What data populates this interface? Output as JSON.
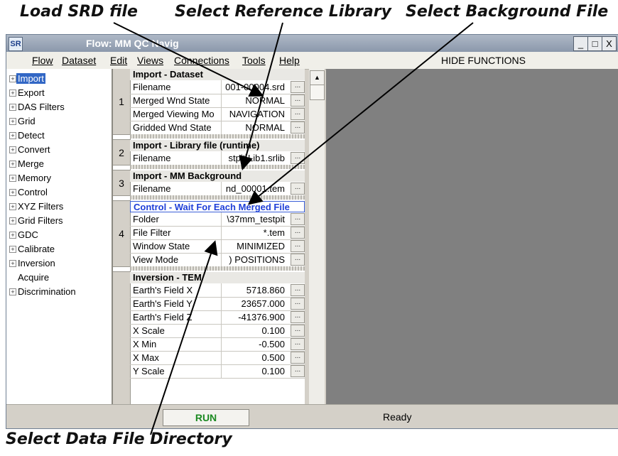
{
  "annotations": {
    "load_srd": "Load SRD file",
    "select_ref_library": "Select Reference Library",
    "select_background": "Select Background File",
    "select_data_dir": "Select Data File Directory"
  },
  "window": {
    "icon_text": "SR",
    "title": "Flow: MM QC Navig",
    "min_glyph": "_",
    "max_glyph": "□",
    "close_glyph": "X"
  },
  "menu": [
    "Flow",
    "Dataset",
    "Edit",
    "Views",
    "Connections",
    "Tools",
    "Help"
  ],
  "hide_functions": "HIDE FUNCTIONS",
  "tree": [
    {
      "label": "Import",
      "expander": true,
      "selected": true
    },
    {
      "label": "Export",
      "expander": true
    },
    {
      "label": "DAS Filters",
      "expander": true
    },
    {
      "label": "Grid",
      "expander": true
    },
    {
      "label": "Detect",
      "expander": true
    },
    {
      "label": "Convert",
      "expander": true
    },
    {
      "label": "Merge",
      "expander": true
    },
    {
      "label": "Memory",
      "expander": true
    },
    {
      "label": "Control",
      "expander": true
    },
    {
      "label": "XYZ Filters",
      "expander": true
    },
    {
      "label": "Grid Filters",
      "expander": true
    },
    {
      "label": "GDC",
      "expander": true
    },
    {
      "label": "Calibrate",
      "expander": true
    },
    {
      "label": "Inversion",
      "expander": true
    },
    {
      "label": "Acquire",
      "expander": false
    },
    {
      "label": "Discrimination",
      "expander": true
    }
  ],
  "sections": [
    {
      "number": "1",
      "header": "Import - Dataset",
      "rows": [
        {
          "key": "Filename",
          "value": "001-00004.srd"
        },
        {
          "key": "Merged Wnd State",
          "value": "NORMAL"
        },
        {
          "key": "Merged Viewing Mo",
          "value": "NAVIGATION"
        },
        {
          "key": "Gridded Wnd State",
          "value": "NORMAL"
        }
      ]
    },
    {
      "number": "2",
      "header": "Import - Library file (runtime)",
      "rows": [
        {
          "key": "Filename",
          "value": "stpit\\Lib1.srlib"
        }
      ]
    },
    {
      "number": "3",
      "header": "Import - MM Background",
      "rows": [
        {
          "key": "Filename",
          "value": "nd_00001.tem"
        }
      ]
    },
    {
      "number": "4",
      "header": "Control - Wait For Each Merged File",
      "header_blue": true,
      "rows": [
        {
          "key": "Folder",
          "value": "\\37mm_testpit"
        },
        {
          "key": "File Filter",
          "value": "*.tem"
        },
        {
          "key": "Window State",
          "value": "MINIMIZED"
        },
        {
          "key": "View Mode",
          "value": ") POSITIONS"
        }
      ]
    },
    {
      "number": "",
      "header": "Inversion - TEM",
      "rows": [
        {
          "key": "Earth's Field X",
          "value": "5718.860"
        },
        {
          "key": "Earth's Field Y",
          "value": "23657.000"
        },
        {
          "key": "Earth's Field Z",
          "value": "-41376.900"
        },
        {
          "key": "X Scale",
          "value": "0.100"
        },
        {
          "key": "X Min",
          "value": "-0.500"
        },
        {
          "key": "X Max",
          "value": "0.500"
        },
        {
          "key": "Y Scale",
          "value": "0.100"
        }
      ]
    }
  ],
  "ellipsis_label": "...",
  "scroll_up_glyph": "▲",
  "scroll_down_glyph": "▼",
  "run_label": "RUN",
  "status": "Ready",
  "colors": {
    "canvas": "#808080",
    "selection": "#3267c5",
    "run_text": "#1c8a22",
    "blue_header": "#1f3fd8"
  }
}
